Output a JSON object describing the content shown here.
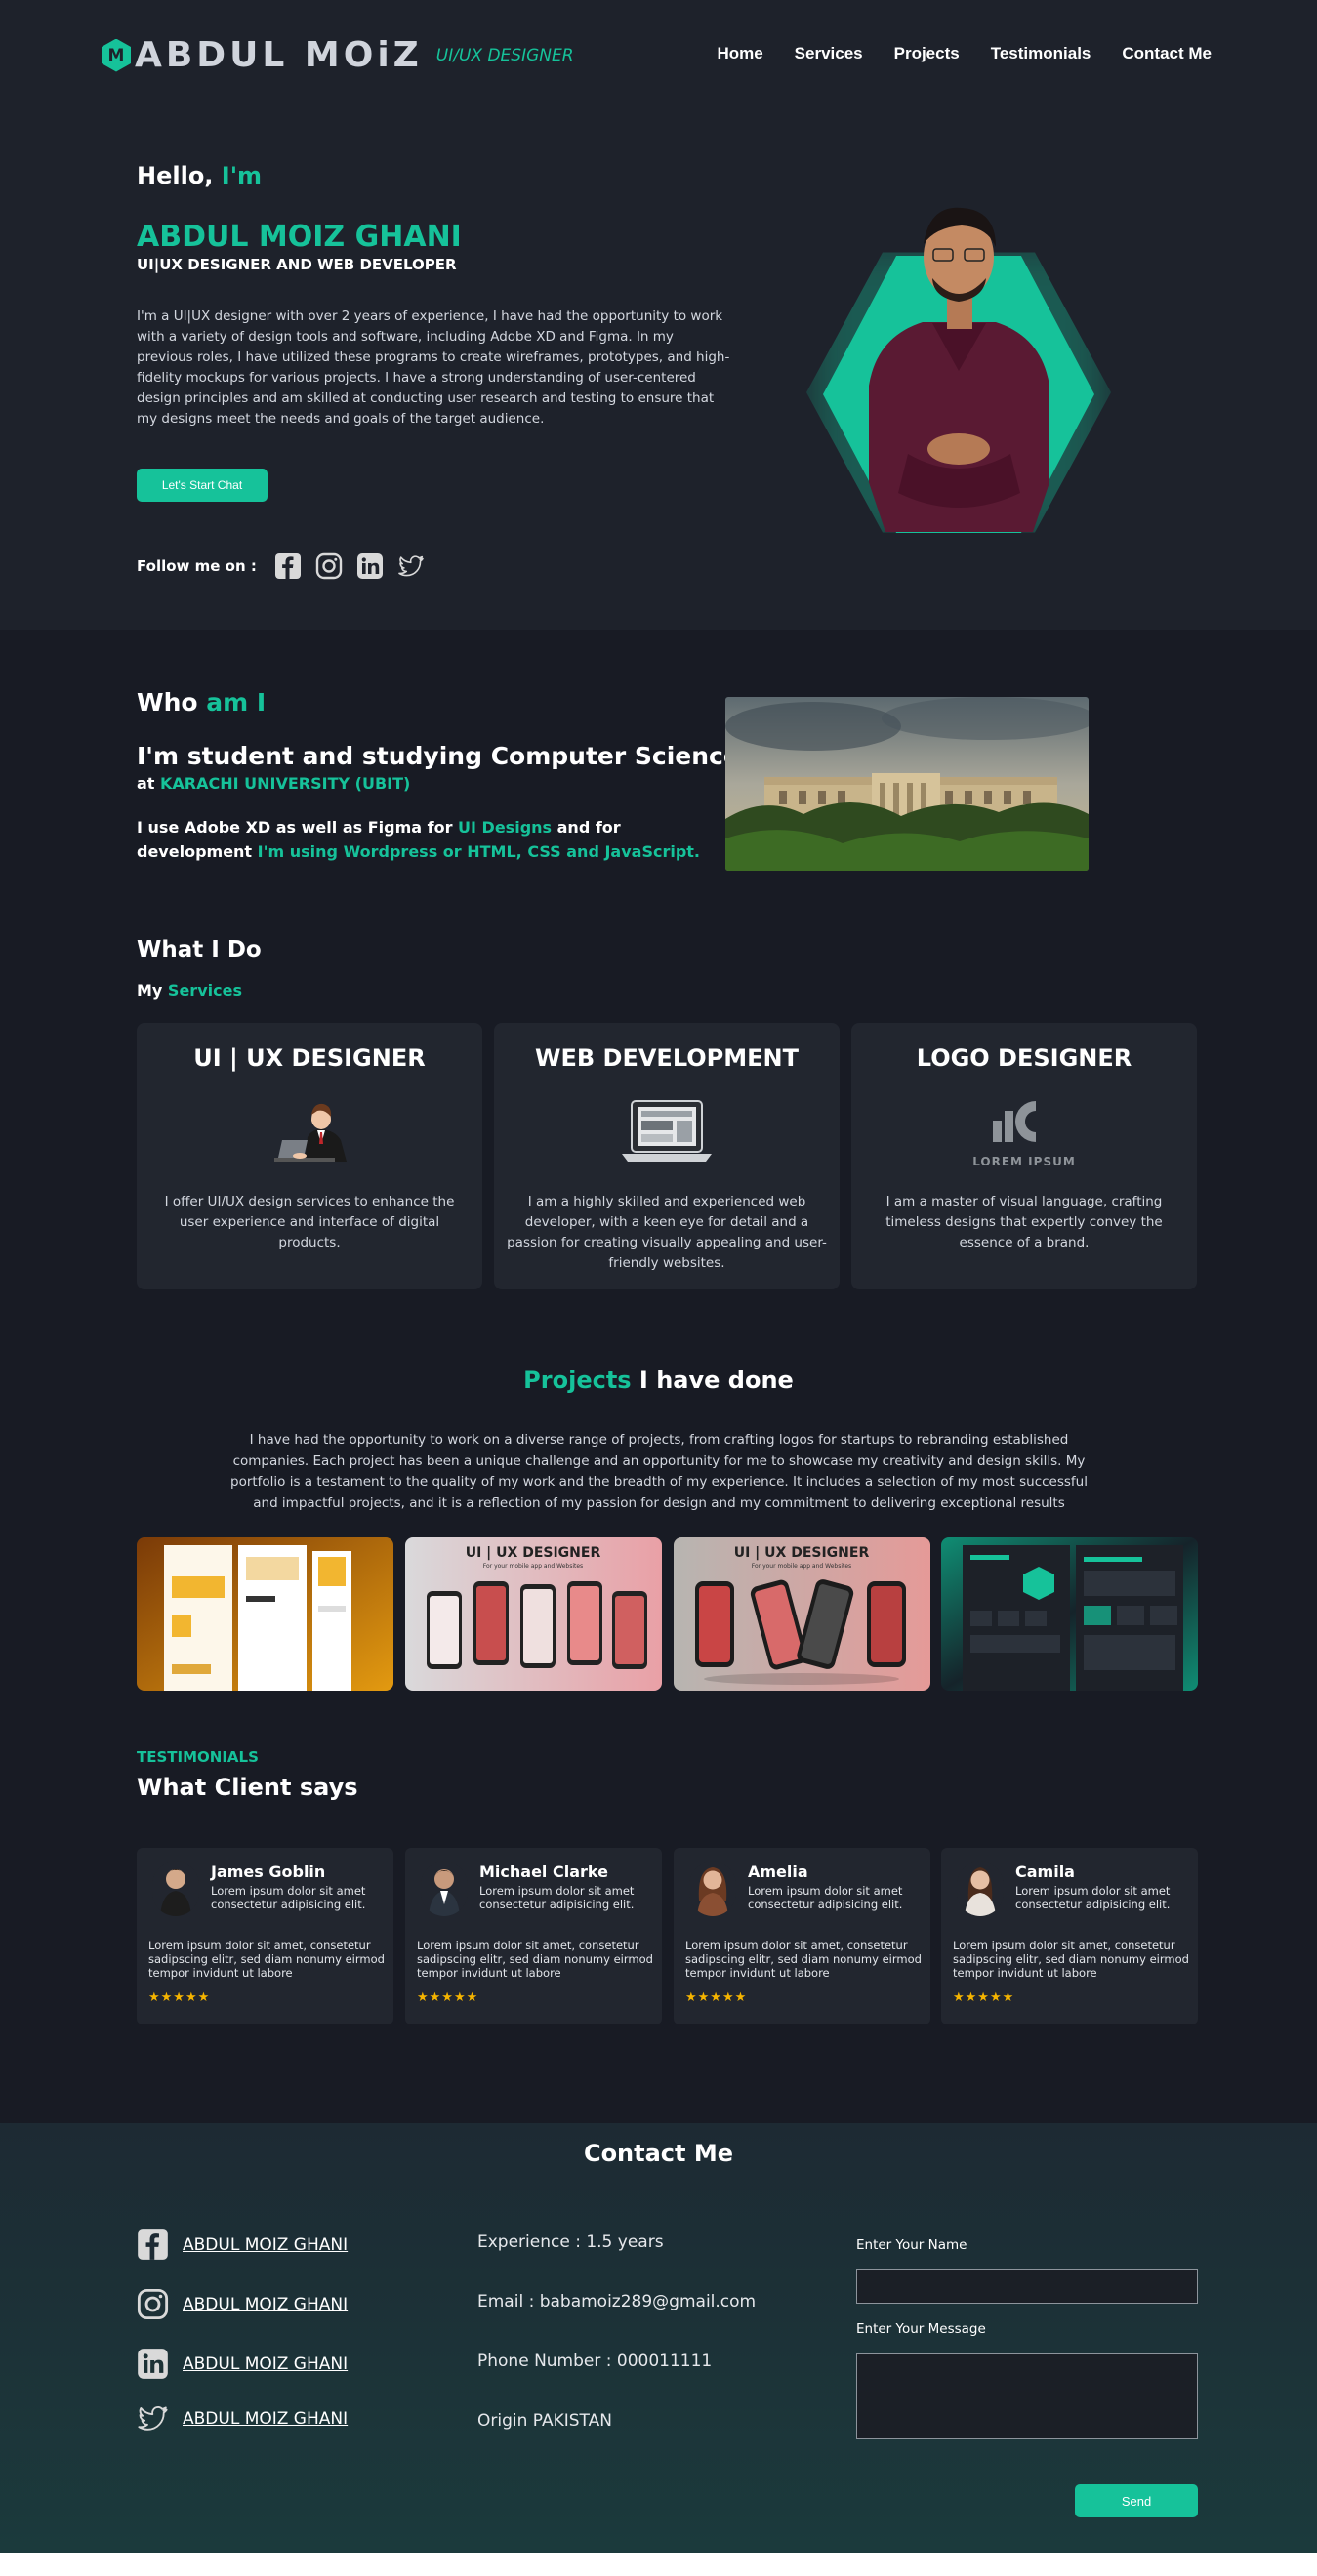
{
  "header": {
    "logo_mark": "M",
    "logo_name": "ABDUL MOiZ",
    "logo_sub": "UI/UX DESIGNER",
    "nav": [
      "Home",
      "Services",
      "Projects",
      "Testimonials",
      "Contact Me"
    ]
  },
  "hero": {
    "hello": "Hello, ",
    "im": "I'm",
    "name": "ABDUL MOIZ GHANI",
    "role": "UI|UX DESIGNER AND WEB DEVELOPER",
    "bio": "I'm a UI|UX designer with over 2 years of experience, I have had the opportunity to work with a variety of design tools and software, including Adobe XD and Figma. In my previous roles, I have utilized these programs to create wireframes, prototypes, and high-fidelity mockups for various projects. I have a strong understanding of user-centered design principles and am skilled at conducting user research and testing to ensure that my designs meet the needs and goals of the target audience.",
    "cta": "Let's Start Chat",
    "follow_label": "Follow me on :"
  },
  "who": {
    "heading_a": "Who ",
    "heading_b": "am I",
    "title": "I'm student and studying Computer Science",
    "at": "at ",
    "university": "KARACHI UNIVERSITY (UBIT)",
    "desc_a": "I use Adobe XD as well as Figma for ",
    "desc_b": "UI Designs",
    "desc_c": " and for development ",
    "desc_d": "I'm using Wordpress or HTML, CSS and JavaScript."
  },
  "services": {
    "heading": "What I Do",
    "sub_a": "My ",
    "sub_b": "Services",
    "items": [
      {
        "title": "UI | UX DESIGNER",
        "desc": "I offer UI/UX design services to enhance the user experience and interface of digital products."
      },
      {
        "title": "WEB DEVELOPMENT",
        "desc": "I am a highly skilled and experienced web developer, with a keen eye for detail and a passion for creating visually appealing and user-friendly websites."
      },
      {
        "title": "LOGO DESIGNER",
        "desc": "I am a master of visual language, crafting timeless designs that expertly convey the essence of a brand.",
        "logo_text": "LOREM IPSUM"
      }
    ]
  },
  "projects": {
    "heading_a": "Projects",
    "heading_b": " I have done",
    "desc": "I have had the opportunity to work on a diverse range of projects, from crafting logos for startups to rebranding established companies. Each project has been a unique challenge and an opportunity for me to showcase my creativity and design skills. My portfolio is a testament to the quality of my work and the breadth of my experience. It includes a selection of my most successful and impactful projects, and it is a reflection of my passion for design and my commitment to delivering exceptional results",
    "thumb_title": "UI | UX DESIGNER",
    "thumb_sub": "For your mobile app and Websites"
  },
  "testimonials": {
    "label": "TESTIMONIALS",
    "title": "What Client says",
    "items": [
      {
        "name": "James Goblin",
        "role": "Lorem ipsum dolor sit amet consectetur adipisicing elit.",
        "text": "Lorem ipsum dolor sit amet, consetetur sadipscing elitr, sed diam nonumy eirmod tempor invidunt ut labore",
        "stars": "★★★★★"
      },
      {
        "name": "Michael Clarke",
        "role": "Lorem ipsum dolor sit amet consectetur adipisicing elit.",
        "text": "Lorem ipsum dolor sit amet, consetetur sadipscing elitr, sed diam nonumy eirmod tempor invidunt ut labore",
        "stars": "★★★★★"
      },
      {
        "name": "Amelia",
        "role": "Lorem ipsum dolor sit amet consectetur adipisicing elit.",
        "text": "Lorem ipsum dolor sit amet, consetetur sadipscing elitr, sed diam nonumy eirmod tempor invidunt ut labore",
        "stars": "★★★★★"
      },
      {
        "name": "Camila",
        "role": "Lorem ipsum dolor sit amet consectetur adipisicing elit.",
        "text": "Lorem ipsum dolor sit amet, consetetur sadipscing elitr, sed diam nonumy eirmod tempor invidunt ut labore",
        "stars": "★★★★★"
      }
    ]
  },
  "contact": {
    "title": "Contact Me",
    "links": [
      {
        "icon": "facebook-icon",
        "label": "ABDUL MOIZ GHANI"
      },
      {
        "icon": "instagram-icon",
        "label": "ABDUL MOIZ GHANI"
      },
      {
        "icon": "linkedin-icon",
        "label": "ABDUL MOIZ GHANI"
      },
      {
        "icon": "twitter-icon",
        "label": "ABDUL MOIZ GHANI"
      }
    ],
    "info": [
      "Experience : 1.5 years",
      "Email : babamoiz289@gmail.com",
      "Phone Number : 000011111",
      "Origin PAKISTAN"
    ],
    "name_label": "Enter Your Name",
    "name_value": "",
    "message_label": "Enter Your Message",
    "message_value": "",
    "send": "Send"
  },
  "colors": {
    "accent": "#16c29a",
    "hero_bg": "#1e222b",
    "body_bg": "#181b24",
    "card_bg": "#22262f",
    "star": "#f5b400"
  }
}
